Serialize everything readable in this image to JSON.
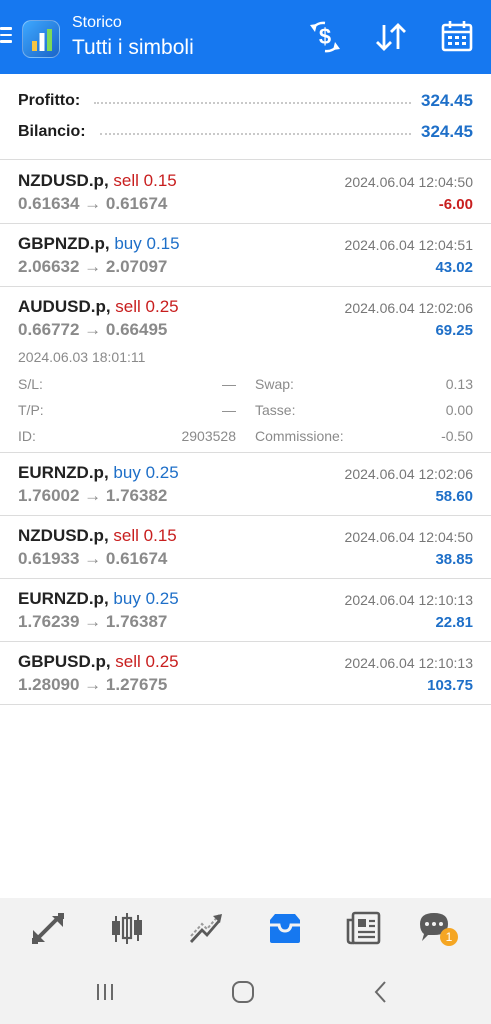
{
  "header": {
    "subtitle": "Storico",
    "title": "Tutti i simboli",
    "icons": [
      "menu-icon",
      "app-logo",
      "currency-exchange-icon",
      "sort-icon",
      "calendar-icon"
    ],
    "bg_color": "#1678f0"
  },
  "summary": {
    "profit_label": "Profitto:",
    "profit_value": "324.45",
    "balance_label": "Bilancio:",
    "balance_value": "324.45"
  },
  "trades": [
    {
      "symbol": "NZDUSD.p,",
      "side": "sell",
      "volume": "0.15",
      "prices": "0.61634 → 0.61674",
      "time": "2024.06.04 12:04:50",
      "profit": "-6.00"
    },
    {
      "symbol": "GBPNZD.p,",
      "side": "buy",
      "volume": "0.15",
      "prices": "2.06632 → 2.07097",
      "time": "2024.06.04 12:04:51",
      "profit": "43.02"
    },
    {
      "symbol": "AUDUSD.p,",
      "side": "sell",
      "volume": "0.25",
      "prices": "0.66772 → 0.66495",
      "time": "2024.06.04 12:02:06",
      "profit": "69.25",
      "details": {
        "open_time": "2024.06.03 18:01:11",
        "sl_label": "S/L:",
        "sl_value": "—",
        "tp_label": "T/P:",
        "tp_value": "—",
        "id_label": "ID:",
        "id_value": "2903528",
        "swap_label": "Swap:",
        "swap_value": "0.13",
        "taxes_label": "Tasse:",
        "taxes_value": "0.00",
        "commission_label": "Commissione:",
        "commission_value": "-0.50"
      }
    },
    {
      "symbol": "EURNZD.p,",
      "side": "buy",
      "volume": "0.25",
      "prices": "1.76002 → 1.76382",
      "time": "2024.06.04 12:02:06",
      "profit": "58.60"
    },
    {
      "symbol": "NZDUSD.p,",
      "side": "sell",
      "volume": "0.15",
      "prices": "0.61933 → 0.61674",
      "time": "2024.06.04 12:04:50",
      "profit": "38.85"
    },
    {
      "symbol": "EURNZD.p,",
      "side": "buy",
      "volume": "0.25",
      "prices": "1.76239 → 1.76387",
      "time": "2024.06.04 12:10:13",
      "profit": "22.81"
    },
    {
      "symbol": "GBPUSD.p,",
      "side": "sell",
      "volume": "0.25",
      "prices": "1.28090 → 1.27675",
      "time": "2024.06.04 12:10:13",
      "profit": "103.75"
    }
  ],
  "bottom_nav": {
    "items": [
      "quotes-icon",
      "chart-icon",
      "trade-icon",
      "history-icon",
      "news-icon",
      "chat-icon"
    ],
    "active": "history-icon",
    "chat_badge": "1",
    "active_color": "#1678f0",
    "icon_color": "#5a5a5a"
  },
  "colors": {
    "sell": "#c81e1e",
    "buy": "#1e6fc8",
    "positive": "#1e6fc8",
    "negative": "#c81e1e"
  }
}
